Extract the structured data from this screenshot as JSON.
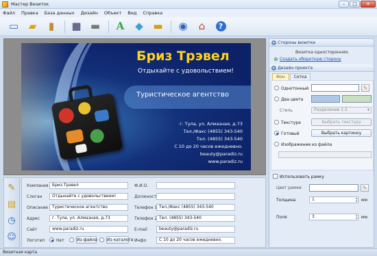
{
  "window": {
    "title": "Мастер Визиток",
    "minimize": "–",
    "maximize": "□",
    "close": "✕"
  },
  "menu": [
    "Файл",
    "Правка",
    "База данных",
    "Дизайн",
    "Объект",
    "Вид",
    "Справка"
  ],
  "toolbar": [
    {
      "name": "new-icon",
      "glyph": "📄"
    },
    {
      "name": "open-icon",
      "glyph": "📂"
    },
    {
      "name": "clipboard-icon",
      "glyph": "📋"
    },
    {
      "name": "save-icon",
      "glyph": "💾"
    },
    {
      "name": "print-icon",
      "glyph": "🖨"
    },
    {
      "name": "text-icon",
      "glyph": "A"
    },
    {
      "name": "shapes-icon",
      "glyph": "◆"
    },
    {
      "name": "image-icon",
      "glyph": "▬"
    },
    {
      "name": "search-icon",
      "glyph": "🔍"
    },
    {
      "name": "home-icon",
      "glyph": "⌂"
    },
    {
      "name": "help-icon",
      "glyph": "?"
    }
  ],
  "card": {
    "title": "Бриз Трэвел",
    "slogan": "Отдыхайте с удовольствием!",
    "description": "Туристическое агентство",
    "lines": [
      "г. Тула, ул. Алмазная, д.73",
      "Тел./Факс (4855) 343-540",
      "Тел. (4855) 343-540",
      "С 10 до 20 часов ежедневно.",
      "beauty@paradiz.ru",
      "www.paradiz.ru"
    ],
    "colors": {
      "title": "#ffd21f",
      "background": "#13307a"
    }
  },
  "form": {
    "company_label": "Компания",
    "company_value": "Бриз Трэвел",
    "slogan_label": "Слоган",
    "slogan_value": "Отдыхайте с удовольствием!",
    "description_label": "Описание",
    "description_value": "Туристическое агентство",
    "address_label": "Адрес",
    "address_value": "г. Тула, ул. Алмазная, д.73",
    "site_label": "Сайт",
    "site_value": "www.paradiz.ru",
    "logo_label": "Логотип",
    "logo_none": "Нет",
    "logo_file": "Из файла",
    "logo_catalog": "Из каталога",
    "fio_label": "Ф.И.О.",
    "fio_value": "",
    "position_label": "Должность",
    "position_value": "",
    "phone1_label": "Телефон 1",
    "phone1_value": "Тел./Факс (4855) 343-540",
    "phone2_label": "Телефон 2",
    "phone2_value": "Тел. (4855) 343-540",
    "email_label": "E-mail",
    "email_value": "beauty@paradiz.ru",
    "info_label": "Инфо",
    "info_value": "С 10 до 20 часов ежедневно."
  },
  "right_panel": {
    "sides_header": "Стороны визитки",
    "sides_text": "Визитка односторонняя.",
    "sides_link": "Создать оборотную сторону",
    "design_header": "Дизайн проекта",
    "tabs": [
      "Фон",
      "Сетка"
    ],
    "option_solid": "Однотонный",
    "option_two": "Два цвета",
    "style_label": "Стиль",
    "style_value": "Разделение 1:1",
    "option_texture": "Текстура",
    "texture_button": "Выбрать текстуру",
    "option_ready": "Готовый",
    "ready_button": "Выбрать картинку",
    "option_file": "Изображение из файла",
    "use_frame": "Использовать рамку",
    "frame_color_label": "Цвет рамки",
    "thickness_label": "Толщина",
    "thickness_value": "1",
    "field_label": "Поля",
    "field_value": "3",
    "unit": "мм",
    "two_color_1": "#aec8e8",
    "two_color_2": "#c9dfc2"
  },
  "left_tools": [
    {
      "name": "edit-text-icon",
      "glyph": "✎"
    },
    {
      "name": "card-icon",
      "glyph": "▤"
    },
    {
      "name": "clock-icon",
      "glyph": "◷"
    },
    {
      "name": "user-icon",
      "glyph": "☺"
    }
  ],
  "status": "Визитная карта"
}
